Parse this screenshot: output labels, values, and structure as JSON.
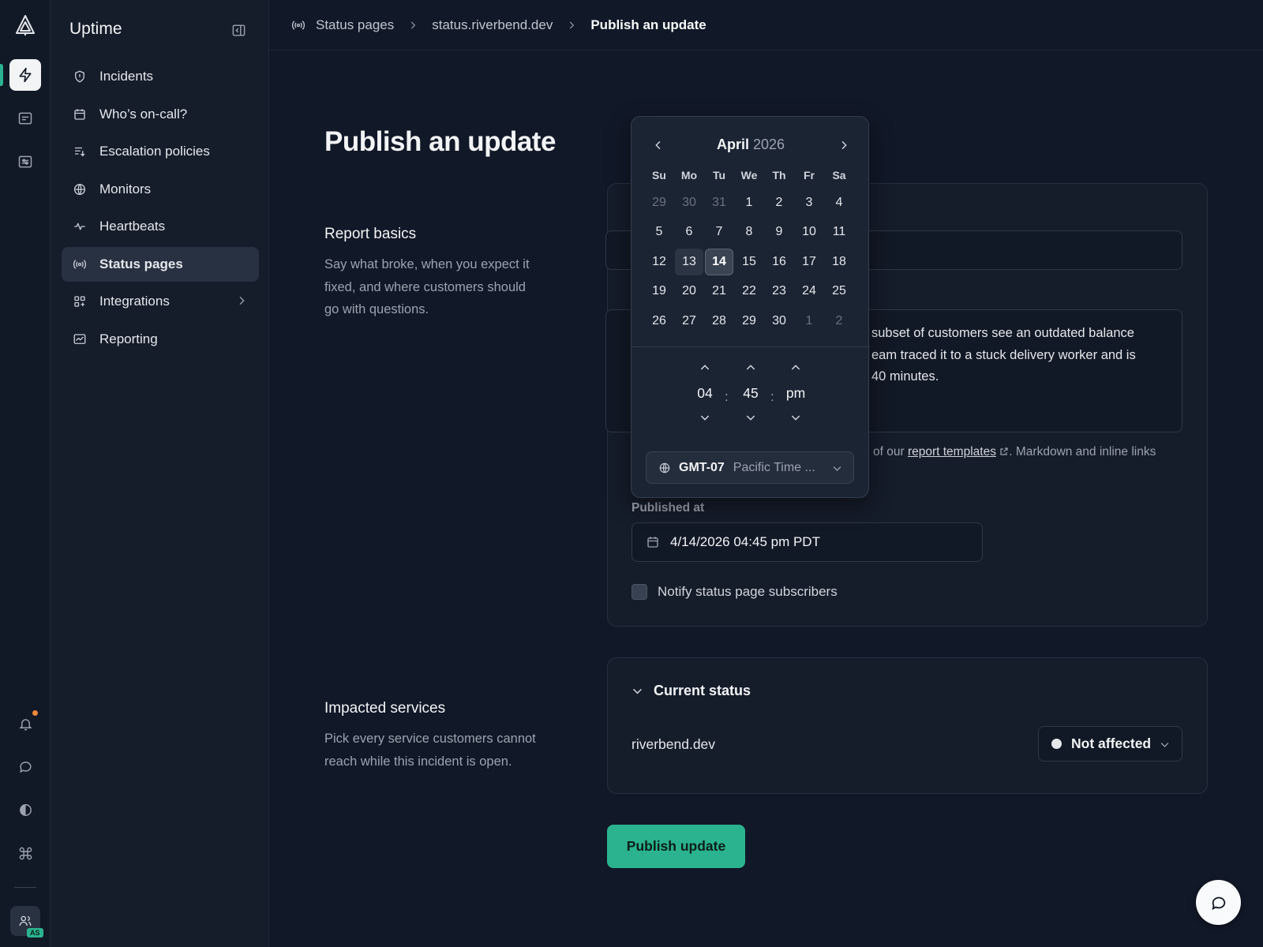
{
  "rail": {
    "icons": [
      "logo-icon",
      "lightning-icon",
      "list-icon",
      "sliders-icon",
      "bell-icon",
      "chat-icon",
      "contrast-icon",
      "command-icon",
      "team-icon"
    ],
    "avatar_initials": "AS",
    "accent": "#2bb38f",
    "notification_color": "#f0863a"
  },
  "sidebar": {
    "title": "Uptime",
    "items": [
      {
        "label": "Incidents",
        "icon": "shield-icon"
      },
      {
        "label": "Who’s on-call?",
        "icon": "calendar-icon"
      },
      {
        "label": "Escalation policies",
        "icon": "escalation-icon"
      },
      {
        "label": "Monitors",
        "icon": "globe-icon"
      },
      {
        "label": "Heartbeats",
        "icon": "pulse-icon"
      },
      {
        "label": "Status pages",
        "icon": "broadcast-icon",
        "active": true
      },
      {
        "label": "Integrations",
        "icon": "grid-icon",
        "has_submenu": true
      },
      {
        "label": "Reporting",
        "icon": "chart-icon"
      }
    ]
  },
  "breadcrumb": {
    "items": [
      "Status pages",
      "status.riverbend.dev",
      "Publish an update"
    ]
  },
  "page": {
    "title": "Publish an update",
    "report_basics": {
      "heading": "Report basics",
      "description": "Say what broke, when you expect it fixed, and where customers should go with questions."
    },
    "impacted_services": {
      "heading": "Impacted services",
      "description": "Pick every service customers cannot reach while this incident is open."
    }
  },
  "form": {
    "message_visible": "subset of customers see an outdated balance\neam traced it to a stuck delivery worker and is\n40 minutes.",
    "help_prefix": "of our",
    "help_link": "report templates",
    "help_suffix": ". Markdown and inline links",
    "published_at_label": "Published at",
    "published_at_value": "4/14/2026 04:45 pm PDT",
    "notify_label": "Notify status page subscribers",
    "notify_checked": false
  },
  "current_status": {
    "heading": "Current status",
    "service": "riverbend.dev",
    "status": "Not affected"
  },
  "publish_button": "Publish update",
  "date_picker": {
    "month": "April",
    "year": "2026",
    "weekdays": [
      "Su",
      "Mo",
      "Tu",
      "We",
      "Th",
      "Fr",
      "Sa"
    ],
    "days": [
      {
        "d": "29",
        "out": true
      },
      {
        "d": "30",
        "out": true
      },
      {
        "d": "31",
        "out": true
      },
      {
        "d": "1"
      },
      {
        "d": "2"
      },
      {
        "d": "3"
      },
      {
        "d": "4"
      },
      {
        "d": "5"
      },
      {
        "d": "6"
      },
      {
        "d": "7"
      },
      {
        "d": "8"
      },
      {
        "d": "9"
      },
      {
        "d": "10"
      },
      {
        "d": "11"
      },
      {
        "d": "12"
      },
      {
        "d": "13",
        "today": true
      },
      {
        "d": "14",
        "selected": true
      },
      {
        "d": "15"
      },
      {
        "d": "16"
      },
      {
        "d": "17"
      },
      {
        "d": "18"
      },
      {
        "d": "19"
      },
      {
        "d": "20"
      },
      {
        "d": "21"
      },
      {
        "d": "22"
      },
      {
        "d": "23"
      },
      {
        "d": "24"
      },
      {
        "d": "25"
      },
      {
        "d": "26"
      },
      {
        "d": "27"
      },
      {
        "d": "28"
      },
      {
        "d": "29"
      },
      {
        "d": "30"
      },
      {
        "d": "1",
        "out": true
      },
      {
        "d": "2",
        "out": true
      }
    ],
    "time": {
      "hour": "04",
      "minute": "45",
      "period": "pm"
    },
    "timezone": {
      "code": "GMT-07",
      "name": "Pacific Time ..."
    }
  }
}
